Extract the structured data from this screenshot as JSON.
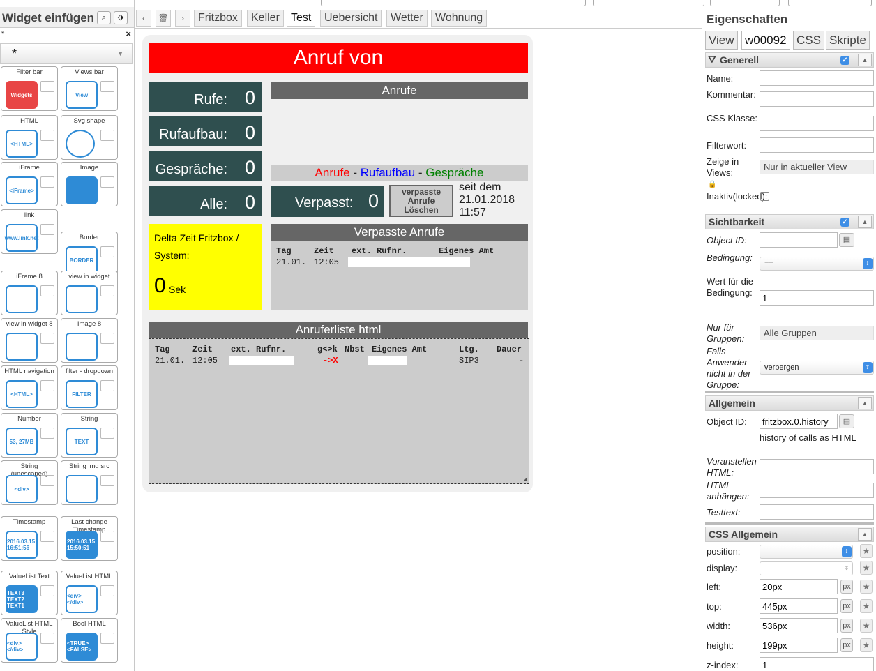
{
  "left_panel": {
    "title": "Widget einfügen",
    "filter_text": "*",
    "filter_clear": "×",
    "group_value": "*",
    "widgets": [
      {
        "label": "Filter bar",
        "icon": "filter-bar-icon",
        "icon_text": "Widgets"
      },
      {
        "label": "Views bar",
        "icon": "views-bar-icon",
        "icon_text": "View"
      },
      {
        "label": "HTML",
        "icon": "html-icon",
        "icon_text": "<HTML>"
      },
      {
        "label": "Svg shape",
        "icon": "circle-shape-icon",
        "icon_text": ""
      },
      {
        "label": "iFrame",
        "icon": "iframe-icon",
        "icon_text": "<iFrame>"
      },
      {
        "label": "Image",
        "icon": "image-icon",
        "icon_text": ""
      },
      {
        "label": "link",
        "icon": "link-icon",
        "icon_text": "www.link.net"
      },
      {
        "label": "Border",
        "icon": "border-icon",
        "icon_text": "BORDER"
      },
      {
        "label": "iFrame 8",
        "icon": "iframe8-icon",
        "icon_text": ""
      },
      {
        "label": "view in widget",
        "icon": "view-in-widget-icon",
        "icon_text": ""
      },
      {
        "label": "view in widget 8",
        "icon": "view-in-widget8-icon",
        "icon_text": ""
      },
      {
        "label": "Image 8",
        "icon": "image8-icon",
        "icon_text": ""
      },
      {
        "label": "HTML navigation",
        "icon": "html-navigation-icon",
        "icon_text": "<HTML>"
      },
      {
        "label": "filter - dropdown",
        "icon": "filter-dropdown-icon",
        "icon_text": "FILTER"
      },
      {
        "label": "Number",
        "icon": "number-icon",
        "icon_text": "53, 27MB"
      },
      {
        "label": "String",
        "icon": "string-icon",
        "icon_text": "TEXT"
      },
      {
        "label": "String (unescaped)",
        "icon": "string-unescaped-icon",
        "icon_text": "<div>"
      },
      {
        "label": "String img src",
        "icon": "string-img-icon",
        "icon_text": ""
      },
      {
        "label": "Timestamp",
        "icon": "timestamp-icon",
        "icon_text": "2016.03.15 16:51:56"
      },
      {
        "label": "Last change Timestamp",
        "icon": "last-change-icon",
        "icon_text": "2016.03.15 15:50:51"
      },
      {
        "label": "ValueList Text",
        "icon": "valuelist-text-icon",
        "icon_text": "TEXT3 TEXT2 TEXT1"
      },
      {
        "label": "ValueList HTML",
        "icon": "valuelist-html-icon",
        "icon_text": "<div> </div>"
      },
      {
        "label": "ValueList HTML Style",
        "icon": "valuelist-html-style-icon",
        "icon_text": "<div> </div>"
      },
      {
        "label": "Bool HTML",
        "icon": "bool-html-icon",
        "icon_text": "<TRUE> <FALSE>"
      }
    ]
  },
  "tabs": {
    "prev": "‹",
    "next": "›",
    "items": [
      "Fritzbox",
      "Keller",
      "Test",
      "Uebersicht",
      "Wetter",
      "Wohnung"
    ],
    "active": "Test"
  },
  "canvas": {
    "header": "Anruf von",
    "counters": [
      {
        "label": "Rufe:",
        "value": "0"
      },
      {
        "label": "Rufaufbau:",
        "value": "0"
      },
      {
        "label": "Gespräche:",
        "value": "0"
      },
      {
        "label": "Alle:",
        "value": "0"
      }
    ],
    "anrufe_title": "Anrufe",
    "legend": {
      "a": "Anrufe",
      "sep1": " - ",
      "b": "Rufaufbau",
      "sep2": " - ",
      "c": "Gespräche"
    },
    "verpasst_label": "Verpasst:",
    "verpasst_value": "0",
    "verpasst_button": "verpasste Anrufe Löschen",
    "seit_dem": "seit dem",
    "seit_date": "21.01.2018",
    "seit_time": "11:57",
    "delta_title": "Delta Zeit Fritzbox / System:",
    "delta_value": "0",
    "delta_unit": "Sek",
    "verpasste_title": "Verpasste Anrufe",
    "verpasste_headers": [
      "Tag",
      "Zeit",
      "ext. Rufnr.",
      "Eigenes Amt"
    ],
    "verpasste_row": [
      "21.01.",
      "12:05"
    ],
    "anruferliste_title": "Anruferliste html",
    "liste_headers": [
      "Tag",
      "Zeit",
      "ext. Rufnr.",
      "g<>k",
      "Nbst",
      "Eigenes Amt",
      "Ltg.",
      "Dauer"
    ],
    "liste_row": [
      "21.01.",
      "12:05",
      "->X",
      "SIP3",
      "-"
    ],
    "colors": {
      "header_red": "#ff0000",
      "tile": "#2f4f4f",
      "bar": "#666666",
      "yellow": "#ffff00",
      "red": "#ff0000",
      "blue": "#0000ff",
      "green": "#008000"
    }
  },
  "props": {
    "title": "Eigenschaften",
    "tabs": [
      "View",
      "w00092",
      "CSS",
      "Skripte"
    ],
    "active_tab": "w00092",
    "generell": "Generell",
    "name_label": "Name:",
    "kommentar_label": "Kommentar:",
    "css_klasse_label": "CSS Klasse:",
    "filterwort_label": "Filterwort:",
    "zeige_label": "Zeige in Views:",
    "zeige_value": "Nur in aktueller View",
    "inaktiv_label": "Inaktiv(locked):",
    "sichtbarkeit": "Sichtbarkeit",
    "objectid_label": "Object ID:",
    "bedingung_label": "Bedingung:",
    "bedingung_value": "==",
    "wert_label": "Wert für die Bedingung:",
    "wert_value": "1",
    "gruppen_label": "Nur für Gruppen:",
    "gruppen_value": "Alle Gruppen",
    "falls_label": "Falls Anwender nicht in der Gruppe:",
    "falls_value": "verbergen",
    "allgemein": "Allgemein",
    "object_id_label": "Object ID:",
    "object_id_value": "fritzbox.0.history",
    "object_id_desc": "history of calls as HTML",
    "voranstellen_label": "Voranstellen HTML:",
    "anhaengen_label": "HTML anhängen:",
    "testtext_label": "Testtext:",
    "css_allgemein": "CSS Allgemein",
    "position_label": "position:",
    "display_label": "display:",
    "left_label": "left:",
    "left_value": "20px",
    "top_label": "top:",
    "top_value": "445px",
    "width_label": "width:",
    "width_value": "536px",
    "height_label": "height:",
    "height_value": "199px",
    "zindex_label": "z-index:",
    "zindex_value": "1",
    "unit": "px"
  }
}
